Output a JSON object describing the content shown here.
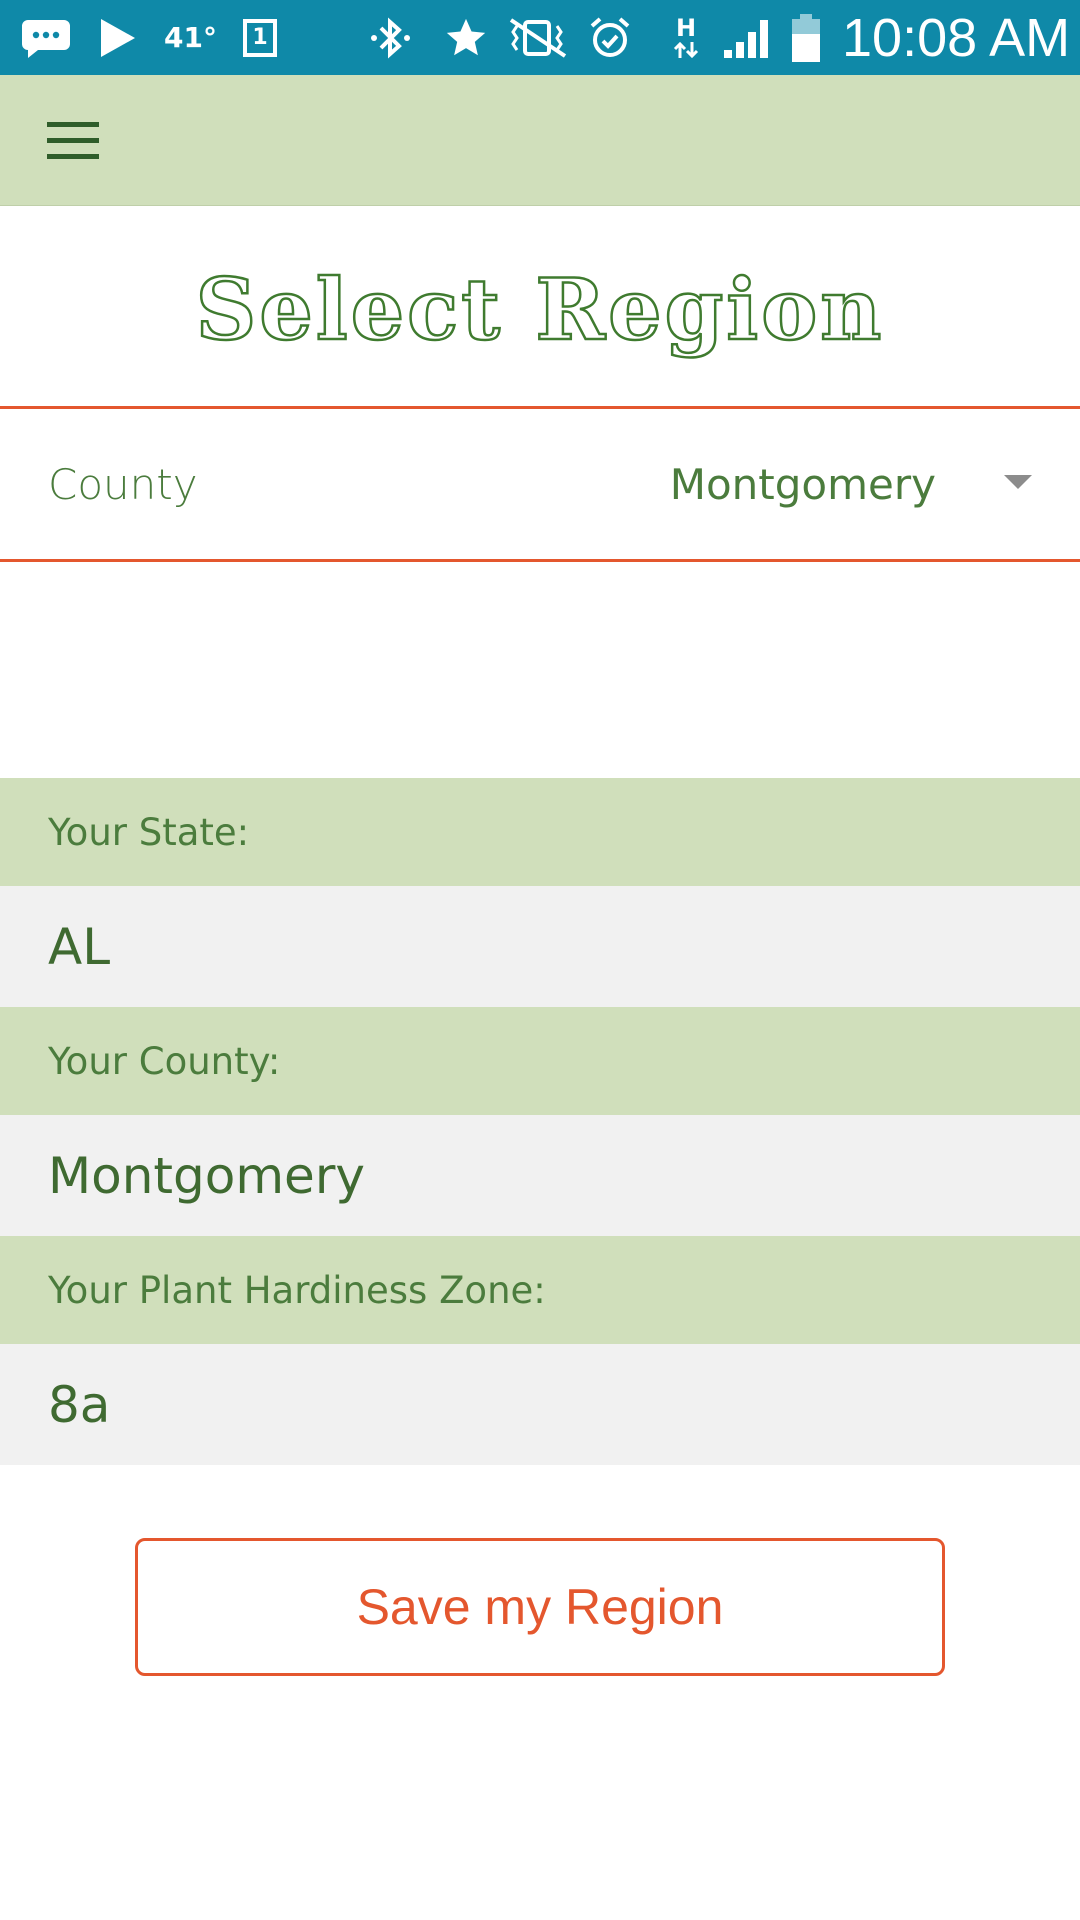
{
  "status_bar": {
    "temperature": "41°",
    "sim_slot": "1",
    "network_type": "H",
    "time": "10:08 AM",
    "icons": [
      "messages-icon",
      "play-store-icon",
      "calendar-icon",
      "bluetooth-icon",
      "star-icon",
      "vibrate-icon",
      "alarm-icon",
      "data-arrows-icon",
      "signal-icon",
      "battery-icon"
    ],
    "color": "#0f89a8"
  },
  "toolbar": {
    "menu_icon": "hamburger-menu-icon",
    "color": "#d0dfbb"
  },
  "page": {
    "title": "Select Region"
  },
  "county_select": {
    "label": "County",
    "selected": "Montgomery",
    "accent": "#e4572e"
  },
  "info": {
    "state_label": "Your State:",
    "state_value": "AL",
    "county_label": "Your County:",
    "county_value": "Montgomery",
    "zone_label": "Your Plant Hardiness Zone:",
    "zone_value": "8a"
  },
  "actions": {
    "save_label": "Save my Region"
  }
}
